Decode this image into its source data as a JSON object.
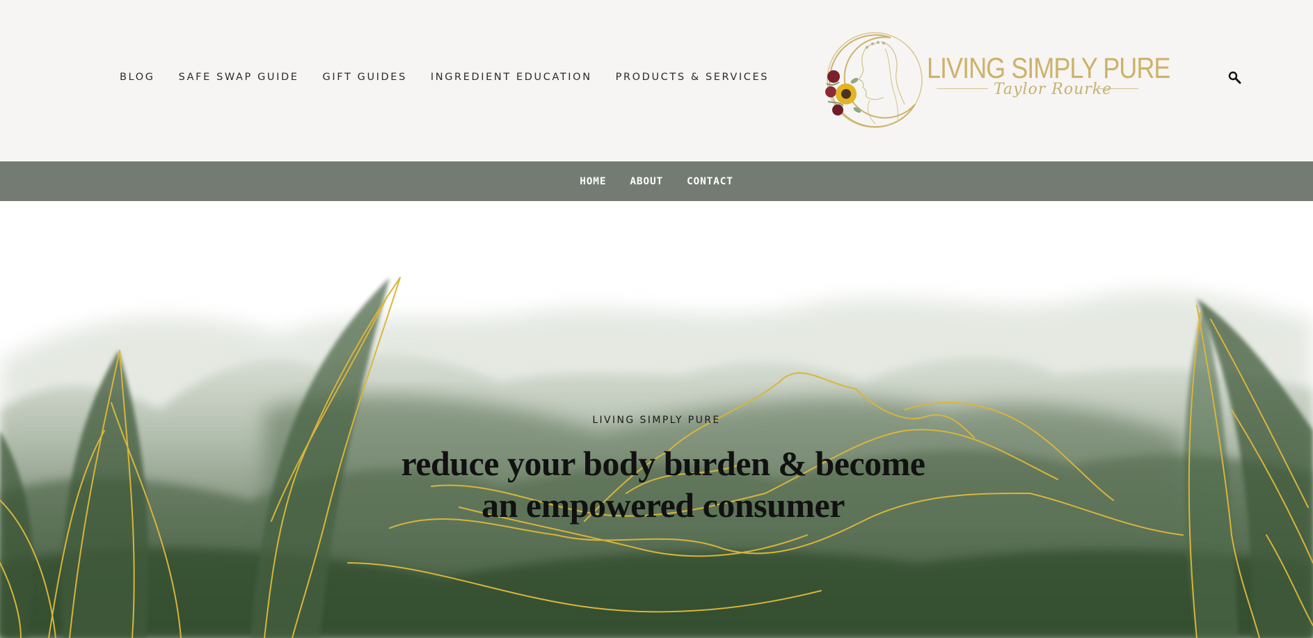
{
  "header": {
    "nav": [
      {
        "label": "BLOG"
      },
      {
        "label": "SAFE SWAP GUIDE"
      },
      {
        "label": "GIFT GUIDES"
      },
      {
        "label": "INGREDIENT EDUCATION"
      },
      {
        "label": "PRODUCTS & SERVICES"
      }
    ],
    "logo": {
      "title": "LIVING SIMPLY PURE",
      "subtitle": "Taylor Rourke"
    },
    "search_icon": "search-icon"
  },
  "secondary_nav": [
    {
      "label": "HOME"
    },
    {
      "label": "ABOUT"
    },
    {
      "label": "CONTACT"
    }
  ],
  "hero": {
    "eyebrow": "LIVING SIMPLY PURE",
    "title_line1": "reduce your body burden & become",
    "title_line2": "an empowered consumer"
  },
  "colors": {
    "header_bg": "#f6f5f3",
    "secondary_nav_bg": "#737b72",
    "logo_gold": "#cdb26a",
    "gold_vein": "#d9b53a",
    "watercolor_green": "#3f5a3a"
  }
}
